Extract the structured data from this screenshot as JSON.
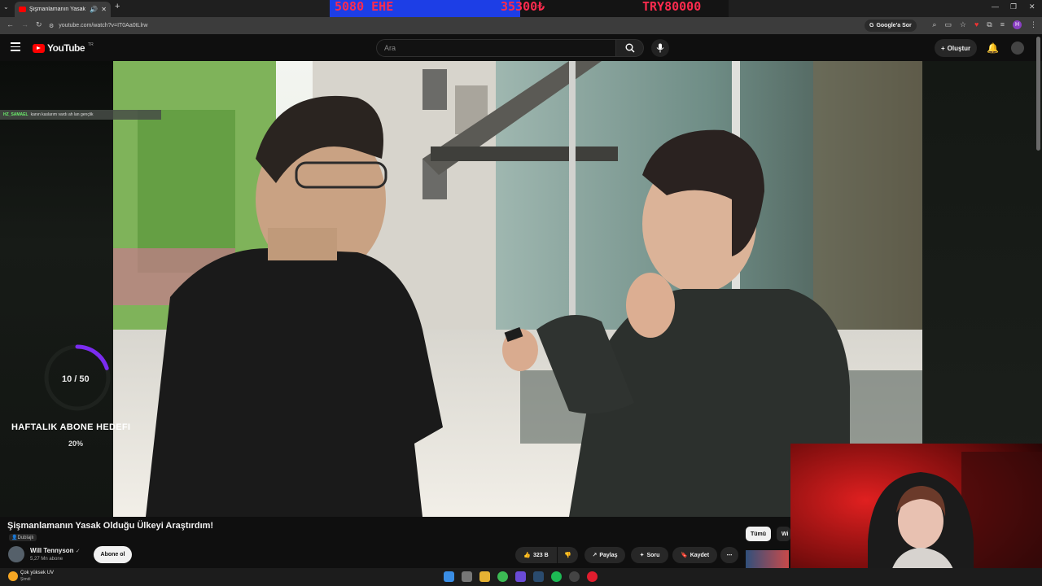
{
  "browser": {
    "tab_title": "Şişmanlamanın Yasak Olduğu...",
    "url": "youtube.com/watch?v=IT0Aa0tLlrw",
    "google_ask": "Google'a Sor",
    "profile_initial": "H"
  },
  "ticker": {
    "left": "5080 EHE",
    "middle": "35300₺",
    "right": "TRY80000"
  },
  "youtube": {
    "logo": "YouTube",
    "country": "TR",
    "search_placeholder": "Ara",
    "create_label": "Oluştur"
  },
  "overlay": {
    "chat_user": "HZ_SAMAEL",
    "chat_text": "kanın kaslarım vardı ah lan gençlik",
    "goal_count": "10 / 50",
    "goal_title": "HAFTALIK ABONE HEDEFI",
    "goal_percent": "20%",
    "goal_progress": 0.2
  },
  "video": {
    "title": "Şişmanlamanın Yasak Olduğu Ülkeyi Araştırdım!",
    "dub_label": "Dublajlı",
    "channel": "Will Tennyson",
    "subscribers": "5,27 Mn abone",
    "subscribe_label": "Abone ol",
    "likes": "323 B",
    "share_label": "Paylaş",
    "ask_label": "Soru",
    "save_label": "Kaydet",
    "chip_all": "Tümü",
    "chip_next": "Wi"
  },
  "taskbar": {
    "weather_title": "Çok yüksek UV",
    "weather_sub": "Şimdi"
  },
  "colors": {
    "yt_red": "#ff0000",
    "ticker_blue": "#1d3ee6",
    "ticker_text": "#ff2b4e",
    "goal_ring": "#7b2cf0"
  }
}
